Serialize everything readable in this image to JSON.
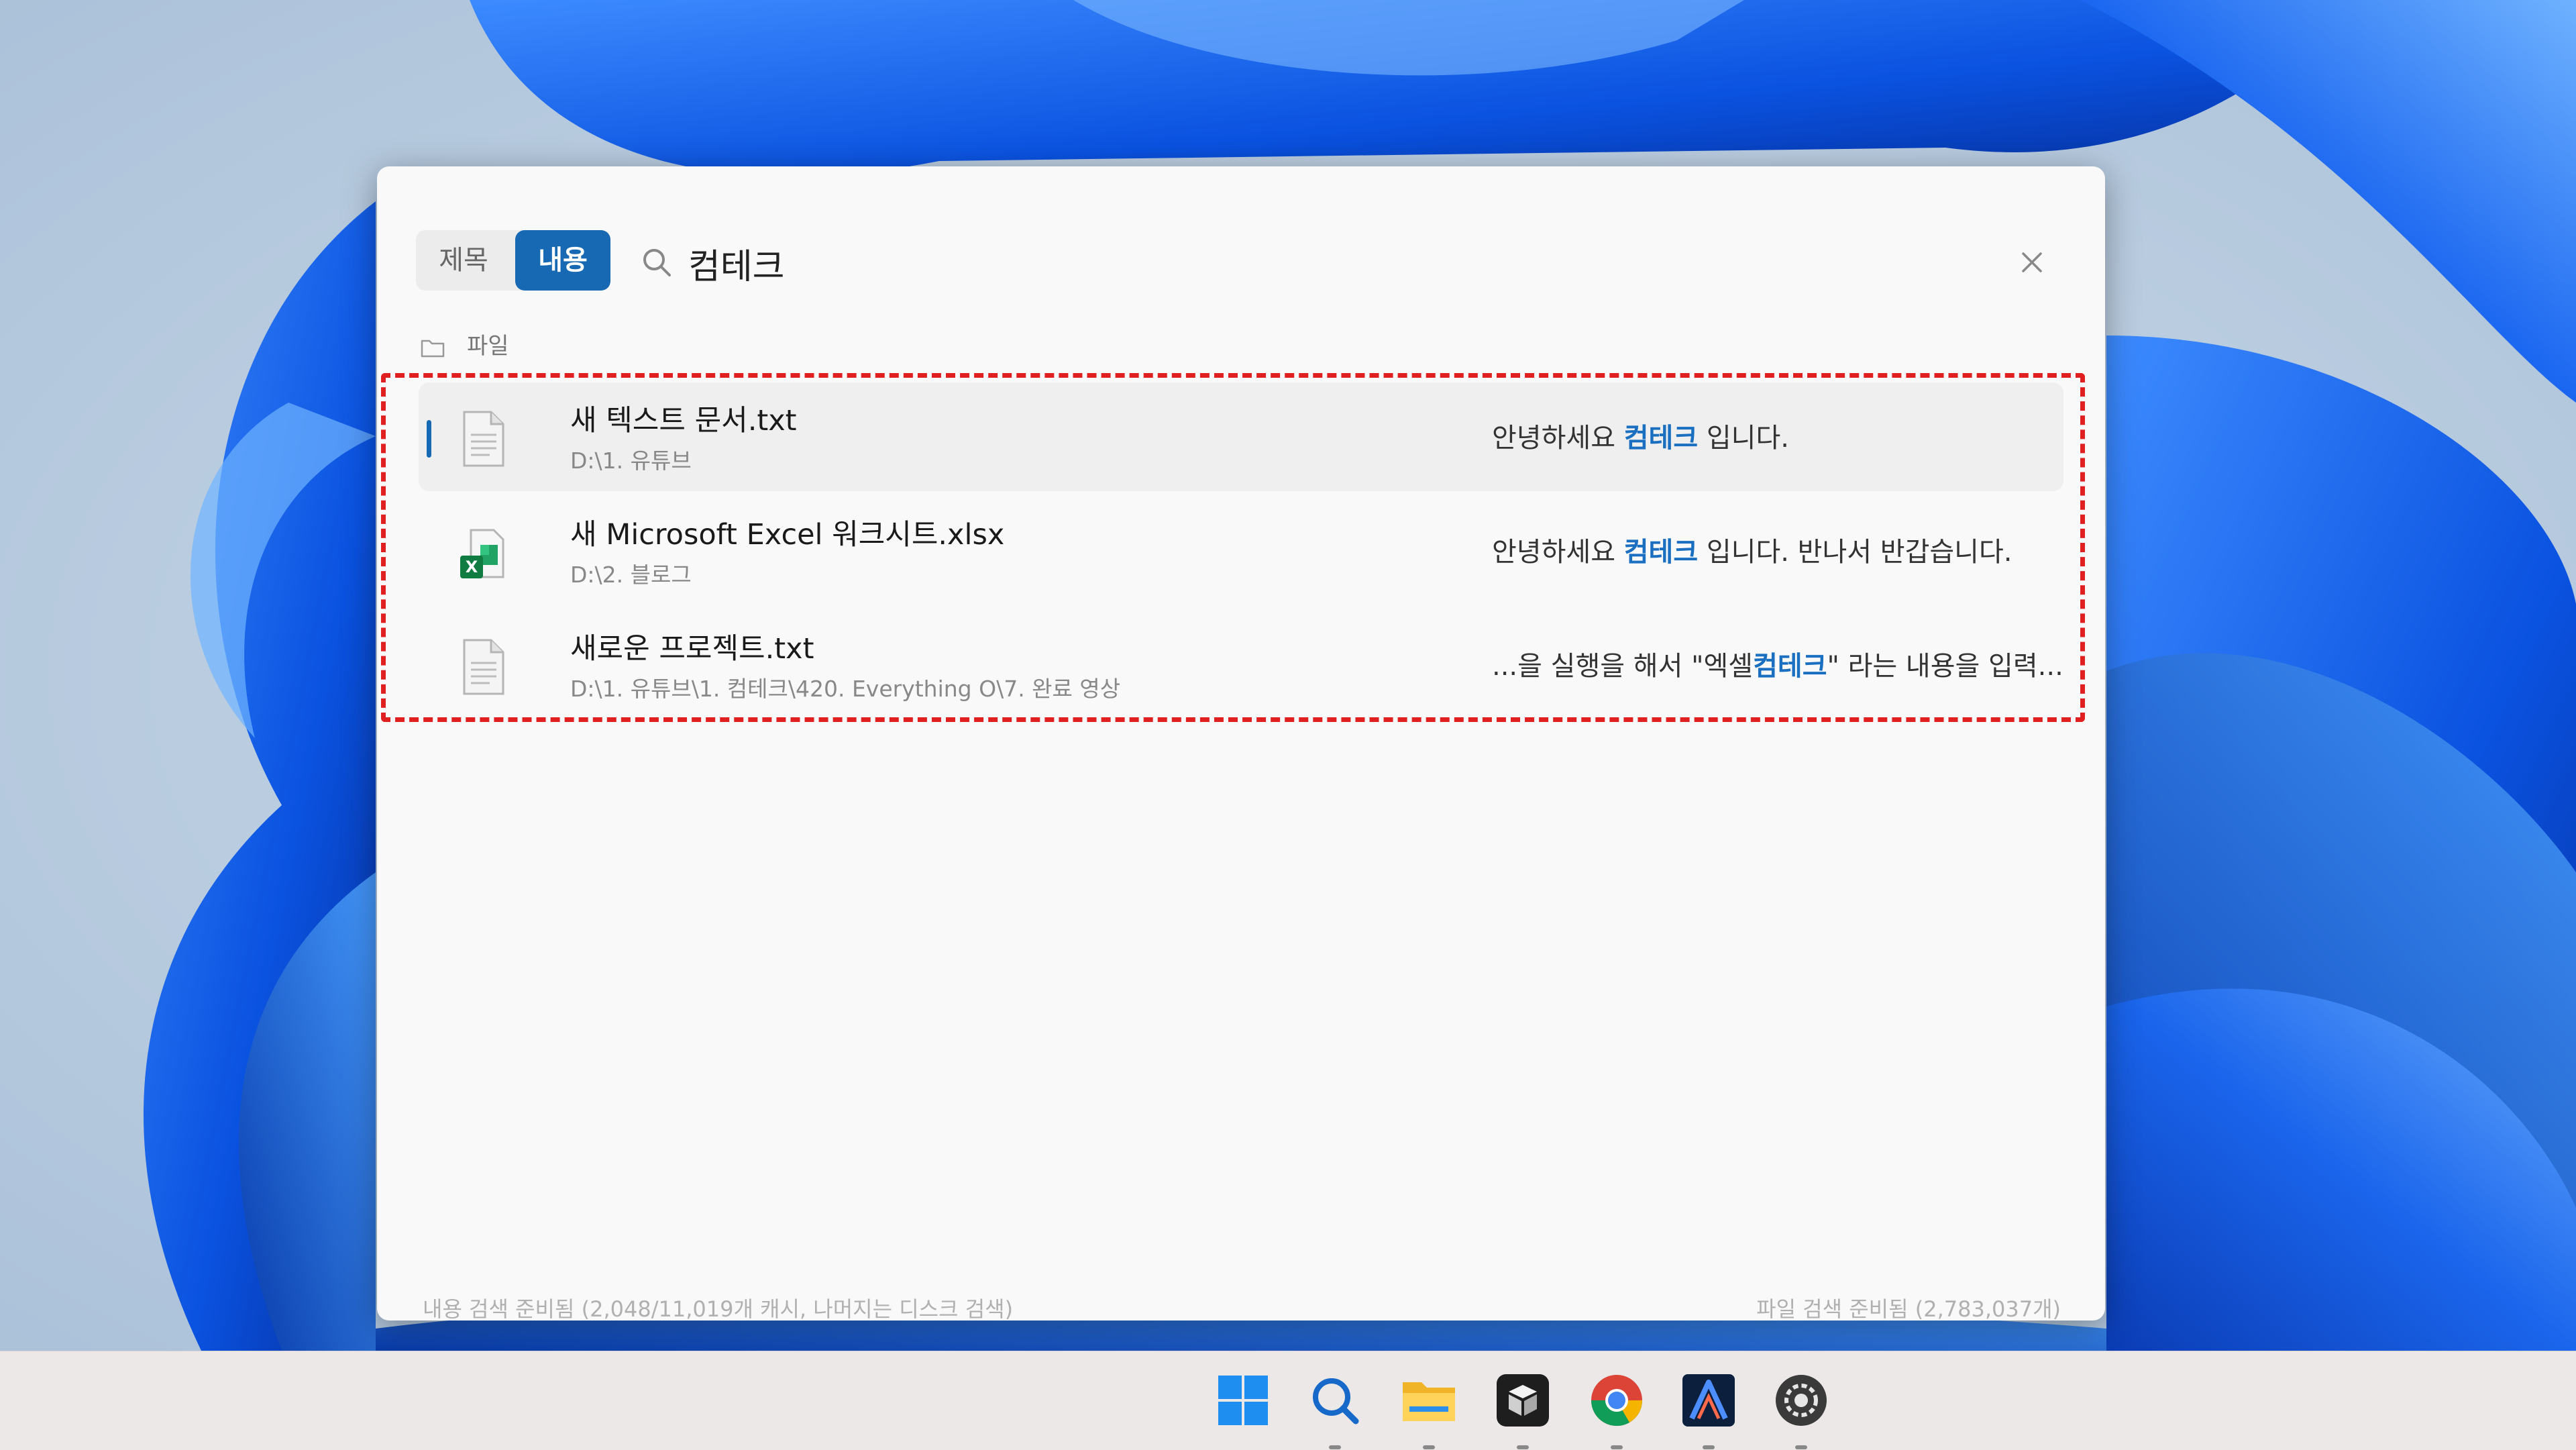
{
  "search": {
    "mode_title": "제목",
    "mode_content": "내용",
    "query": "컴테크",
    "active_mode": "내용"
  },
  "section": {
    "label": "파일",
    "icon": "folder-icon"
  },
  "results": [
    {
      "name": "새 텍스트 문서.txt",
      "path": "D:\\1. 유튜브",
      "icon": "text-file-icon",
      "snippet_before": "안녕하세요 ",
      "snippet_match": "컴테크",
      "snippet_after": " 입니다."
    },
    {
      "name": "새 Microsoft Excel 워크시트.xlsx",
      "path": "D:\\2. 블로그",
      "icon": "excel-file-icon",
      "snippet_before": "안녕하세요 ",
      "snippet_match": "컴테크",
      "snippet_after": " 입니다. 반나서 반갑습니다."
    },
    {
      "name": "새로운 프로젝트.txt",
      "path": "D:\\1. 유튜브\\1. 컴테크\\420. Everything O\\7. 완료 영상",
      "icon": "text-file-icon",
      "snippet_before": "...을 실행을 해서 \"엑셀",
      "snippet_match": "컴테크",
      "snippet_after": "\" 라는 내용을 입력..."
    }
  ],
  "status": {
    "left": "내용 검색 준비됨 (2,048/11,019개 캐시, 나머지는 디스크 검색)",
    "right": "파일 검색 준비됨 (2,783,037개)"
  },
  "taskbar": {
    "apps": [
      "start-icon",
      "search-icon",
      "file-explorer-icon",
      "app-box-icon",
      "chrome-icon",
      "ai-app-icon",
      "settings-app-icon"
    ]
  },
  "colors": {
    "accent": "#1769b3",
    "highlight_text": "#1a6fc0",
    "annotation_box": "#e02020"
  }
}
